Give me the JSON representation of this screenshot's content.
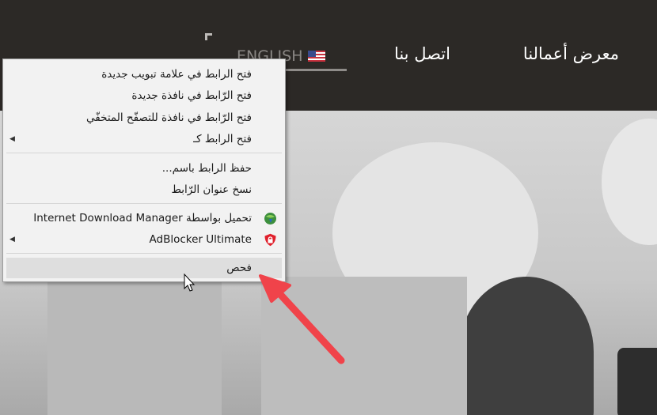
{
  "header": {
    "nav": {
      "portfolio": "معرض أعمالنا",
      "contact": "اتصل بنا",
      "language": "ENGLISH"
    }
  },
  "context_menu": {
    "items": [
      {
        "label": "فتح الرابط في علامة تبويب جديدة"
      },
      {
        "label": "فتح الرّابط في نافذة جديدة"
      },
      {
        "label": "فتح الرّابط في نافذة للتصفّح المتخفّي"
      },
      {
        "label": "فتح الرابط كـ",
        "submenu_glyph": "◀"
      },
      {
        "label": "حفظ الرابط باسم..."
      },
      {
        "label": "نسخ عنوان الرّابط"
      },
      {
        "label_prefix": "تحميل بواسطة",
        "label_app": "Internet Download Manager",
        "icon": "idm-globe-icon"
      },
      {
        "label": "AdBlocker Ultimate",
        "icon": "shield-lock-icon",
        "submenu_glyph": "◀"
      },
      {
        "label": "فحص",
        "highlighted": true
      }
    ]
  },
  "colors": {
    "header_bg": "#2c2926",
    "annotation_arrow": "#f0434a",
    "adblock_red": "#e0202c"
  }
}
